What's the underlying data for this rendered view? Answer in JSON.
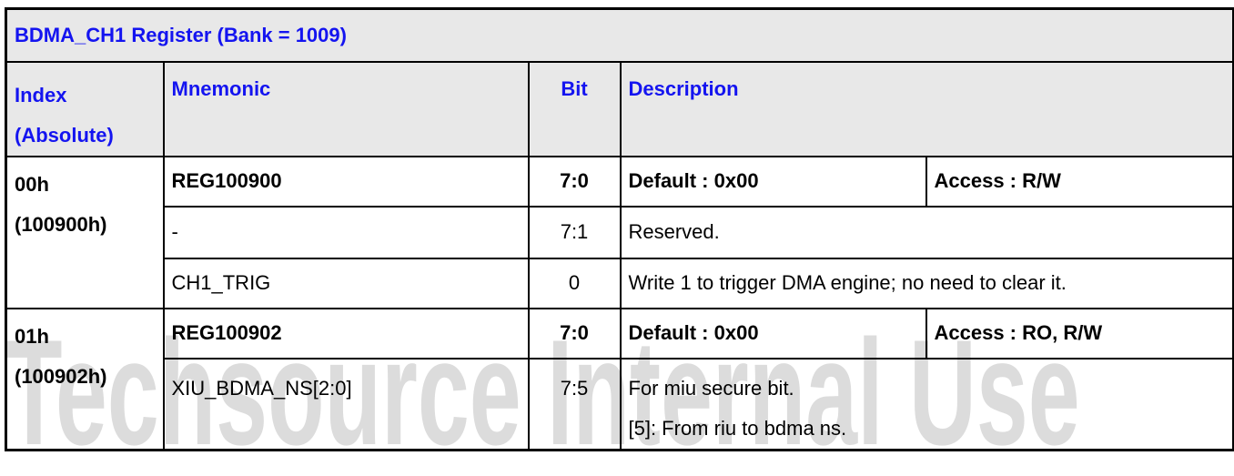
{
  "title": "BDMA_CH1 Register (Bank = 1009)",
  "headers": {
    "index_line1": "Index",
    "index_line2": "(Absolute)",
    "mnemonic": "Mnemonic",
    "bit": "Bit",
    "description": "Description"
  },
  "registers": [
    {
      "index": "00h",
      "absolute": "(100900h)",
      "name": "REG100900",
      "bit": "7:0",
      "default": "Default : 0x00",
      "access": "Access : R/W",
      "fields": [
        {
          "mnemonic": "-",
          "bit": "7:1",
          "description": [
            "Reserved."
          ]
        },
        {
          "mnemonic": "CH1_TRIG",
          "bit": "0",
          "description": [
            "Write 1 to trigger DMA engine; no need to clear it."
          ]
        }
      ]
    },
    {
      "index": "01h",
      "absolute": "(100902h)",
      "name": "REG100902",
      "bit": "7:0",
      "default": "Default : 0x00",
      "access": "Access : RO, R/W",
      "fields": [
        {
          "mnemonic": "XIU_BDMA_NS[2:0]",
          "bit": "7:5",
          "description": [
            "For miu secure bit.",
            "[5]: From riu to bdma ns."
          ]
        }
      ]
    }
  ],
  "watermark": "Techsource Internal Use",
  "colors": {
    "header_text": "#1414f0",
    "header_bg": "#e8e8e8",
    "watermark": "#dcdcdc"
  }
}
